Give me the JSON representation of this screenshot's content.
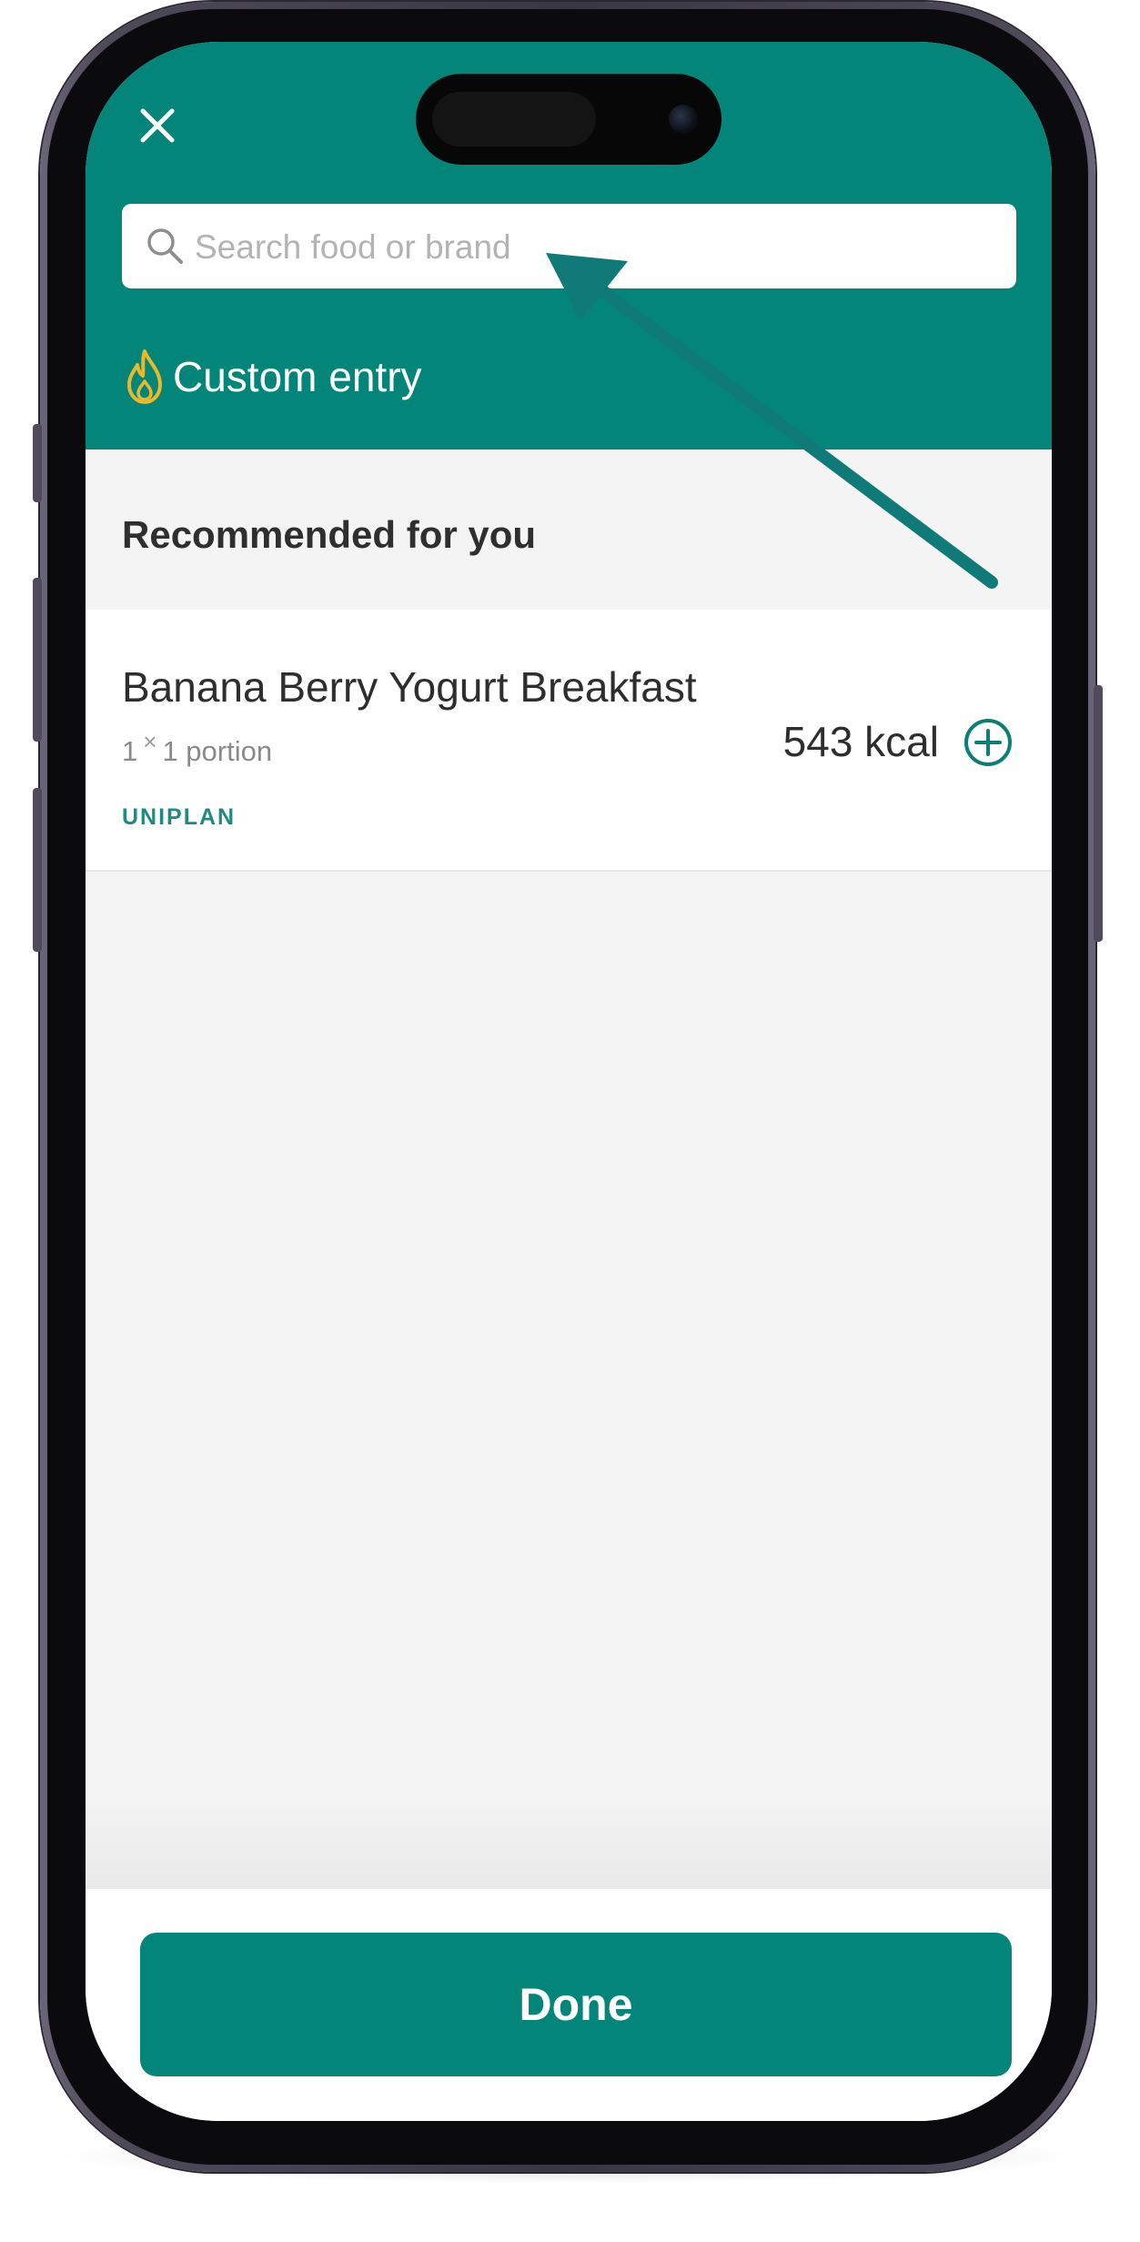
{
  "header": {
    "close_icon": "close-icon",
    "search": {
      "placeholder": "Search food or brand",
      "value": "",
      "icon": "search-icon"
    },
    "custom_entry": {
      "label": "Custom entry",
      "icon": "flame-icon",
      "icon_color": "#e9b92b"
    }
  },
  "recommended": {
    "title": "Recommended for you",
    "items": [
      {
        "name": "Banana Berry Yogurt Breakfast",
        "quantity": "1",
        "multiplier": "×",
        "portion": "1 portion",
        "source": "UNIPLAN",
        "kcal": "543 kcal",
        "add_icon": "plus-circle-icon"
      }
    ]
  },
  "footer": {
    "done_label": "Done"
  },
  "colors": {
    "brand": "#04857a",
    "accent_text": "#1e8a80",
    "background": "#f4f4f4",
    "annotation_arrow": "#107a78"
  }
}
